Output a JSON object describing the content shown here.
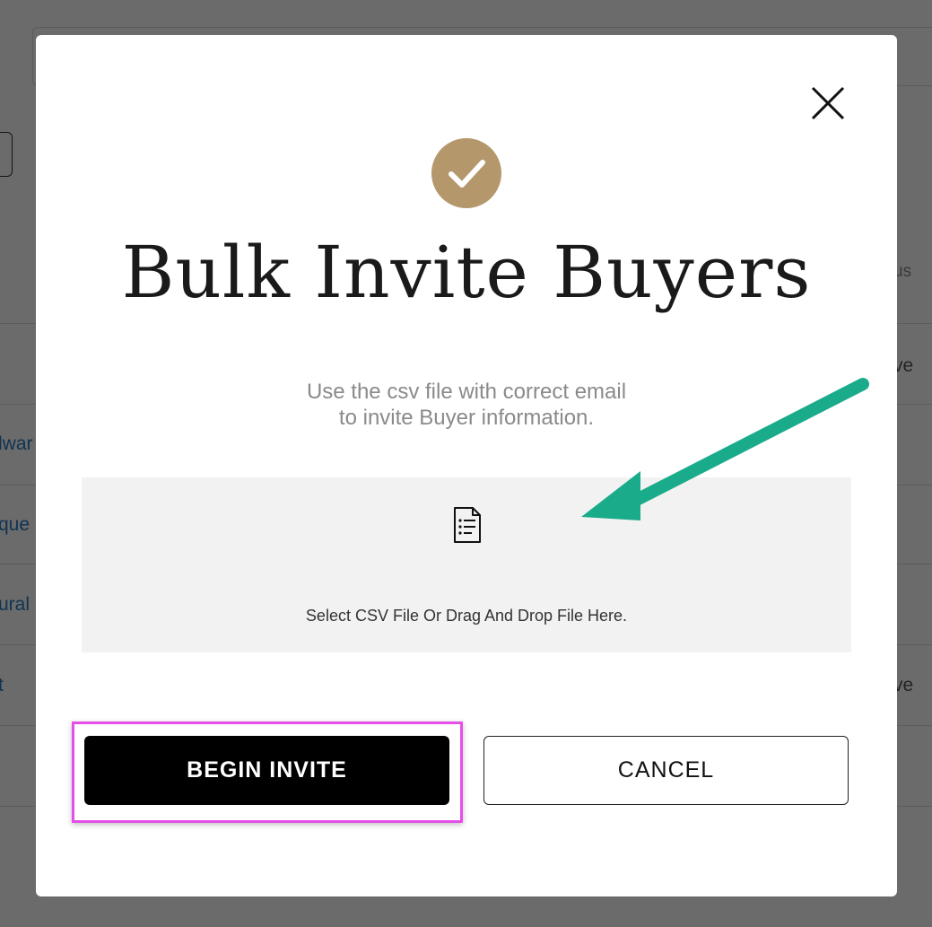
{
  "background": {
    "header_partial": "us",
    "rows": [
      {
        "left": "",
        "right": "ve"
      },
      {
        "left": "lwar",
        "right": ""
      },
      {
        "left": "que",
        "right": ""
      },
      {
        "left": "ural",
        "right": ""
      },
      {
        "left": "t",
        "right": "ve"
      }
    ]
  },
  "modal": {
    "title": "Bulk Invite Buyers",
    "subtitle_line1": "Use the csv file with correct email",
    "subtitle_line2": "to invite Buyer information.",
    "dropzone_text": "Select CSV File Or Drag And Drop File Here.",
    "begin_button": "BEGIN INVITE",
    "cancel_button": "CANCEL",
    "icons": {
      "success": "checkmark-circle-icon",
      "close": "close-icon",
      "file": "document-list-icon"
    }
  },
  "annotations": {
    "arrow_color": "#1aab8a",
    "highlight_color": "#e64ee8"
  },
  "colors": {
    "accent": "#b4986c",
    "overlay": "rgba(0,0,0,0.58)",
    "primary_button": "#000000"
  }
}
